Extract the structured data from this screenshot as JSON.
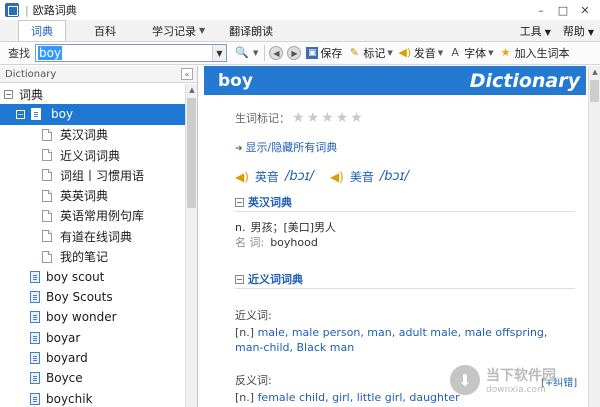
{
  "window": {
    "title": "欧路词典"
  },
  "menu": {
    "tabs": [
      {
        "label": "词典"
      },
      {
        "label": "百科"
      },
      {
        "label": "学习记录"
      },
      {
        "label": "翻译朗读"
      }
    ],
    "right": [
      {
        "label": "工具"
      },
      {
        "label": "帮助"
      }
    ]
  },
  "toolbar": {
    "search_label": "查找",
    "search_value": "boy",
    "save": "保存",
    "mark": "标记",
    "speak": "发音",
    "font": "字体",
    "add_word": "加入生词本"
  },
  "sidebar": {
    "header": "Dictionary",
    "root": "词典",
    "selected": "boy",
    "children": [
      "英汉词典",
      "近义词词典",
      "词组丨习惯用语",
      "英英词典",
      "英语常用例句库",
      "有道在线词典",
      "我的笔记"
    ],
    "words": [
      "boy scout",
      "Boy Scouts",
      "boy wonder",
      "boyar",
      "boyard",
      "Boyce",
      "boychik"
    ]
  },
  "content": {
    "headword": "boy",
    "logo": "Dictionary",
    "star_label": "生词标记：",
    "stars_total": 5,
    "stars_filled": 0,
    "toggle_all": "显示/隐藏所有词典",
    "pron_uk_label": "英音",
    "pron_uk": "/bɔɪ/",
    "pron_us_label": "美音",
    "pron_us": "/bɔɪ/",
    "sec1_title": "英汉词典",
    "sec1_def1_pos": "n.",
    "sec1_def1": "男孩；[美口]男人",
    "sec1_def2_pos": "名 词:",
    "sec1_def2": "boyhood",
    "sec2_title": "近义词词典",
    "syn_label": "近义词:",
    "syn_pos": "[n.]",
    "syn_text": "male, male person, man, adult male, male offspring, man-child, Black man",
    "ant_label": "反义词:",
    "ant_pos": "[n.]",
    "ant_text": "female child, girl, little girl, daughter",
    "more": "[+纠错]"
  },
  "watermark": {
    "line1": "当下软件园",
    "line2": "downxia.com"
  },
  "colors": {
    "accent": "#2479d1",
    "selected_row": "#1f77d4",
    "link": "#1f5fb5"
  }
}
